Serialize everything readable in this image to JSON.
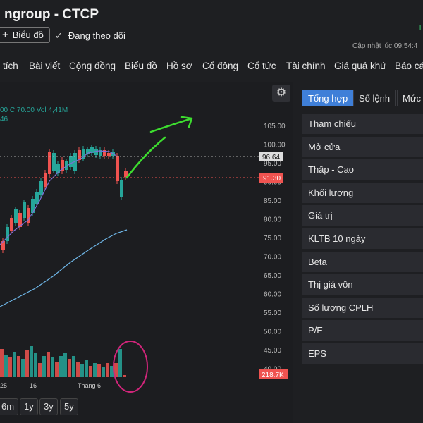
{
  "header": {
    "title": "ngroup - CTCP",
    "chart_button": "Biểu đồ",
    "follow_label": "Đang theo dõi",
    "updated": "Cập nhật lúc  09:54:4"
  },
  "nav": [
    "tích",
    "Bài viết",
    "Cộng đồng",
    "Biểu đồ",
    "Hồ sơ",
    "Cổ đông",
    "Cổ tức",
    "Tài chính",
    "Giá quá khứ",
    "Báo cá"
  ],
  "legend": {
    "ohlc": "00 C 70.00 Vol 4,41M",
    "ma": "46"
  },
  "price_axis": [
    "105.00",
    "100.00",
    "95.00",
    "90.00",
    "85.00",
    "80.00",
    "75.00",
    "70.00",
    "65.00",
    "60.00",
    "55.00",
    "50.00",
    "45.00",
    "40.00"
  ],
  "markers": {
    "ref_price": "96.64",
    "last_price": "91.30",
    "volume": "218.7K"
  },
  "time_axis": [
    "25",
    "16",
    "Tháng 6"
  ],
  "ranges": [
    "6m",
    "1y",
    "3y",
    "5y"
  ],
  "tabs": [
    "Tổng hợp",
    "Sổ lệnh",
    "Mức g"
  ],
  "rows": [
    "Tham chiếu",
    "Mở cửa",
    "Thấp - Cao",
    "Khối lượng",
    "Giá trị",
    "KLTB 10 ngày",
    "Beta",
    "Thị giá vốn",
    "Số lượng CPLH",
    "P/E",
    "EPS"
  ],
  "colors": {
    "up": "#26a69a",
    "down": "#ef5350",
    "accent": "#3f7fd8",
    "annotation_arrow": "#3ddc2f",
    "annotation_circle": "#d0257a"
  },
  "icons": {
    "settings": "gear-icon",
    "chart": "plus-icon",
    "follow": "check-icon"
  }
}
